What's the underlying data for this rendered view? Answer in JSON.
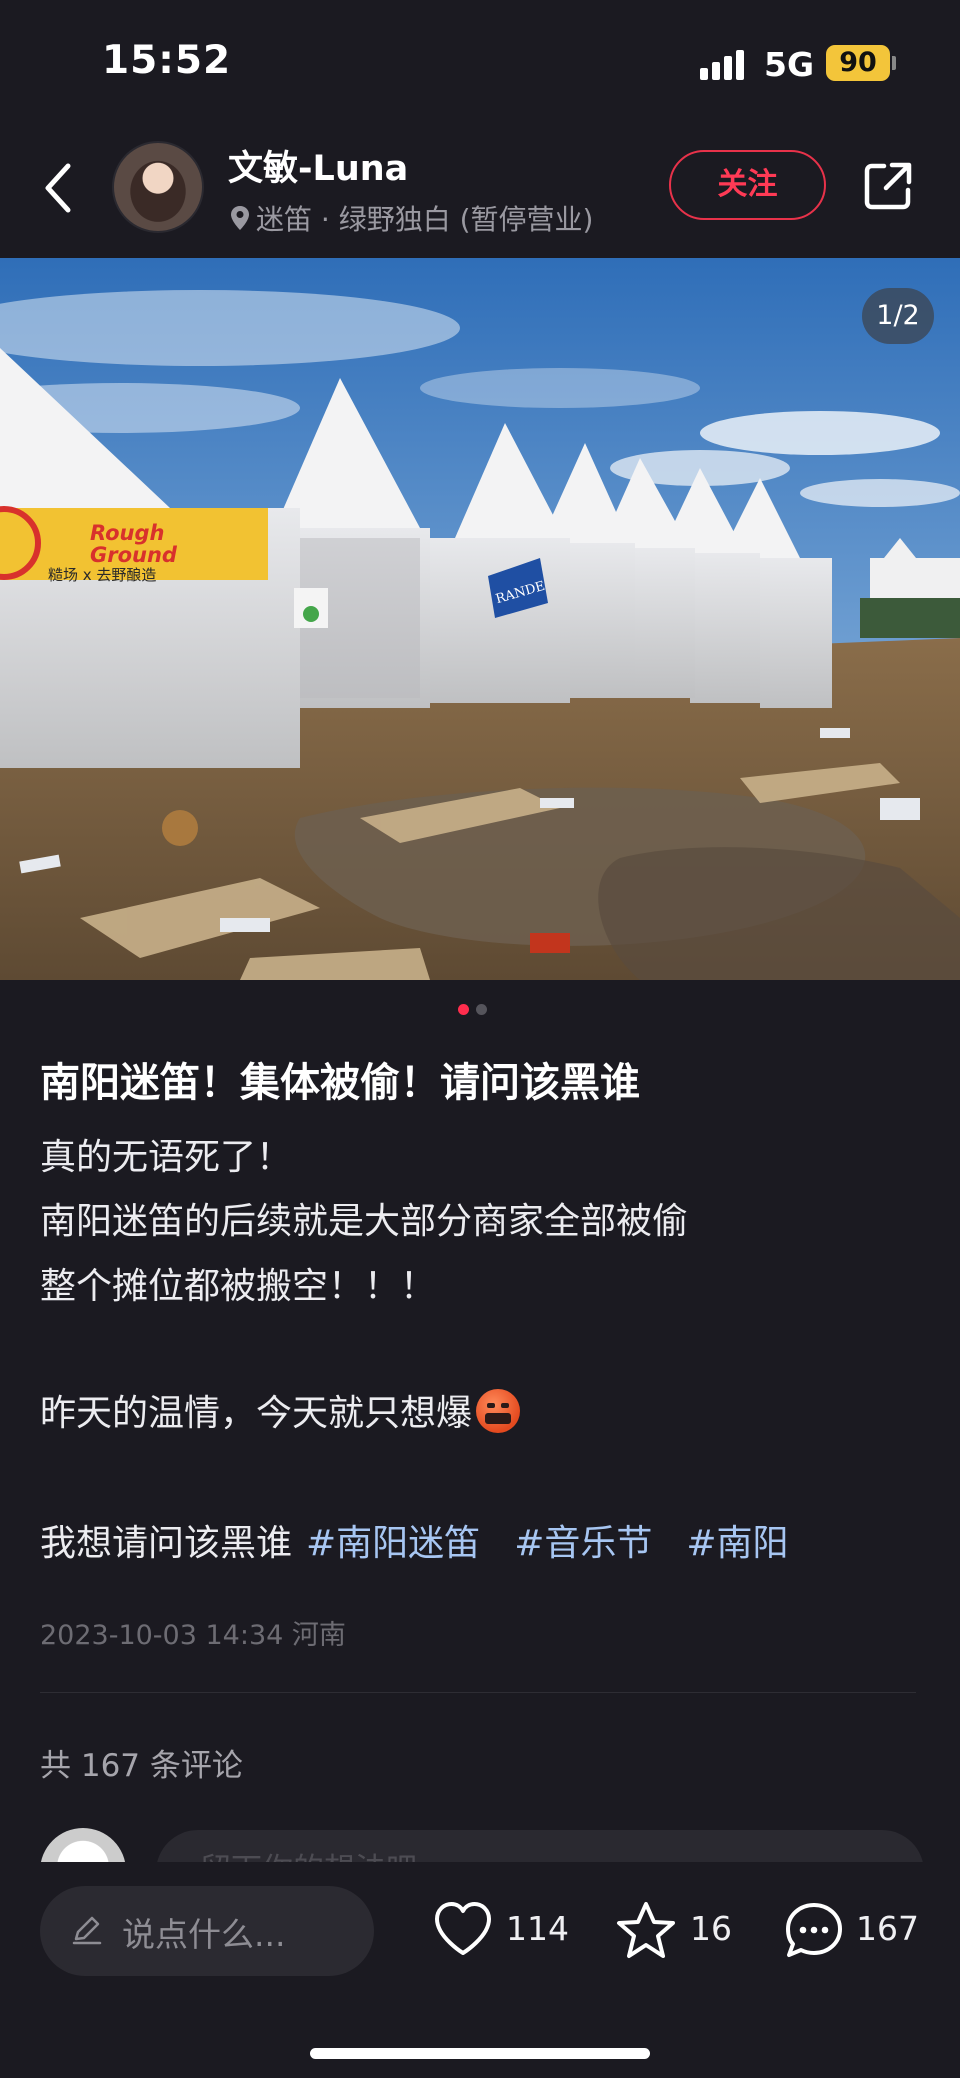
{
  "status_bar": {
    "time": "15:52",
    "network": "5G",
    "battery": "90"
  },
  "header": {
    "author_name": "文敏-Luna",
    "location": "迷笛 · 绿野独白 (暂停营业)",
    "follow_label": "关注"
  },
  "media": {
    "page_indicator": "1/2",
    "sign_brand_line1": "Rough",
    "sign_brand_line2": "Ground",
    "sign_subtitle": "糙场 x 去野酿造",
    "flag_text": "RANDE",
    "active_dot_color": "#ff2d4d"
  },
  "post": {
    "title": "南阳迷笛！集体被偷！请问该黑谁",
    "body_lines": [
      "真的无语死了！",
      "南阳迷笛的后续就是大部分商家全部被偷",
      "整个摊位都被搬空！！！",
      "昨天的温情，今天就只想爆",
      "我想请问该黑谁"
    ],
    "emoji_name": "angry-cursing-face",
    "emoji_text": "&$!#%",
    "hashtags": [
      "#南阳迷笛",
      "#音乐节",
      "#南阳"
    ],
    "date": "2023-10-03 14:34",
    "region": "河南"
  },
  "comments": {
    "count_text": "共 167 条评论",
    "input_placeholder": "留下你的想法吧"
  },
  "bottom_bar": {
    "comment_placeholder": "说点什么...",
    "likes": "114",
    "favorites": "16",
    "comments": "167"
  }
}
